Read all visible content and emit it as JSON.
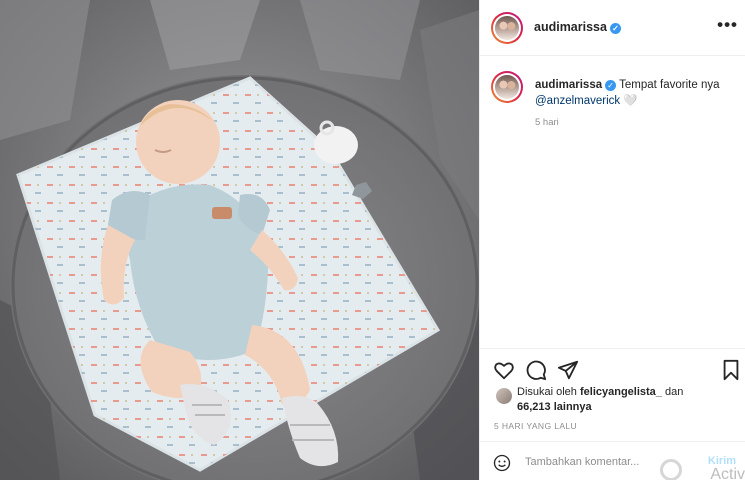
{
  "post": {
    "username": "audimarissa",
    "more_glyph": "•••",
    "verified_glyph": "✓"
  },
  "caption": {
    "username": "audimarissa",
    "text": "Tempat favorite nya",
    "mention": "@anzelmaverick",
    "emoji": "🤍",
    "time": "5 hari"
  },
  "actions": {
    "icons": [
      "heart-icon",
      "comment-icon",
      "share-icon",
      "bookmark-icon"
    ]
  },
  "likes": {
    "prefix": "Disukai oleh",
    "user": "felicyangelista_",
    "connector": "dan",
    "count": "66,213",
    "suffix": "lainnya"
  },
  "timestamp": "5 HARI YANG LALU",
  "comment": {
    "placeholder": "Tambahkan komentar...",
    "send_label": "Kirim"
  },
  "overlay": {
    "watermark": "Activ"
  },
  "colors": {
    "accent": "#0095f6",
    "send_disabled": "#b2dffc",
    "verified": "#3897f0",
    "muted": "#8e8e8e"
  }
}
